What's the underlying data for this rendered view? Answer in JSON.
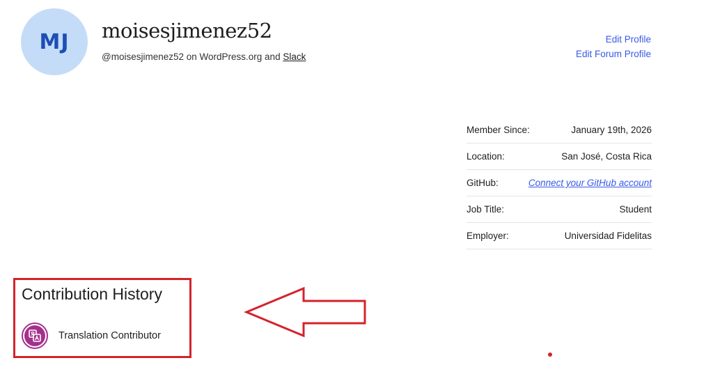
{
  "header": {
    "avatar_initials": "MJ",
    "username": "moisesjimenez52",
    "handle_prefix": "@moisesjimenez52 on WordPress.org and ",
    "slack_link": "Slack"
  },
  "profile_links": {
    "edit_profile": "Edit Profile",
    "edit_forum_profile": "Edit Forum Profile"
  },
  "info": {
    "rows": [
      {
        "label": "Member Since:",
        "value": "January 19th, 2026"
      },
      {
        "label": "Location:",
        "value": "San José, Costa Rica"
      },
      {
        "label": "GitHub:",
        "value": "Connect your GitHub account"
      },
      {
        "label": "Job Title:",
        "value": "Student"
      },
      {
        "label": "Employer:",
        "value": "Universidad Fidelitas"
      }
    ]
  },
  "contribution": {
    "title": "Contribution History",
    "badges": [
      {
        "label": "Translation Contributor",
        "icon": "translation-icon"
      }
    ]
  },
  "colors": {
    "accent_link": "#3858e9",
    "avatar_bg": "#c5dcf8",
    "avatar_text": "#1d4fb5",
    "badge": "#a5308b",
    "annotation": "#d4232c"
  }
}
